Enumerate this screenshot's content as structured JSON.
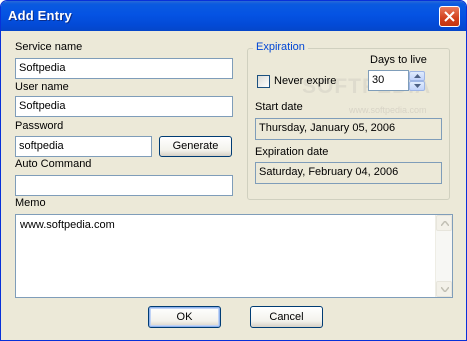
{
  "window": {
    "title": "Add Entry"
  },
  "form": {
    "service_name_label": "Service name",
    "service_name_value": "Softpedia",
    "user_name_label": "User name",
    "user_name_value": "Softpedia",
    "password_label": "Password",
    "password_value": "softpedia",
    "generate_button": "Generate",
    "auto_command_label": "Auto Command",
    "auto_command_value": "",
    "memo_label": "Memo",
    "memo_value": "www.softpedia.com"
  },
  "expiration": {
    "group_label": "Expiration",
    "days_to_live_label": "Days to live",
    "never_expire_label": "Never expire",
    "never_expire_checked": false,
    "days_value": "30",
    "start_date_label": "Start date",
    "start_date_value": "Thursday, January 05, 2006",
    "expiration_date_label": "Expiration date",
    "expiration_date_value": "Saturday, February 04, 2006"
  },
  "buttons": {
    "ok": "OK",
    "cancel": "Cancel"
  },
  "watermark": {
    "text": "SOFTPEDIA",
    "url": "www.softpedia.com"
  },
  "colors": {
    "title_bar": "#0553e3",
    "group_label": "#0046d5",
    "close_button": "#d2401c"
  }
}
